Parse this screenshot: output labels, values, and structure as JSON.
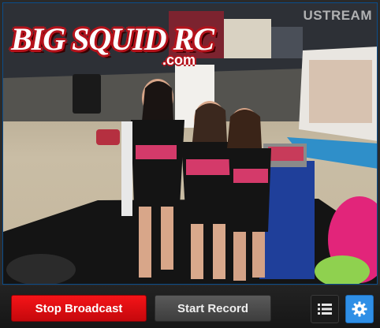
{
  "overlay": {
    "logo_main": "BIG SQUID RC",
    "logo_sub": ".com",
    "watermark": "USTREAM"
  },
  "controls": {
    "stop_label": "Stop Broadcast",
    "record_label": "Start Record",
    "list_icon": "list-icon",
    "settings_icon": "gear-icon"
  },
  "colors": {
    "stop_button": "#e30e12",
    "record_button": "#4a4a4a",
    "settings_button": "#2f8fe6",
    "bar_background": "#1b1b1b"
  }
}
